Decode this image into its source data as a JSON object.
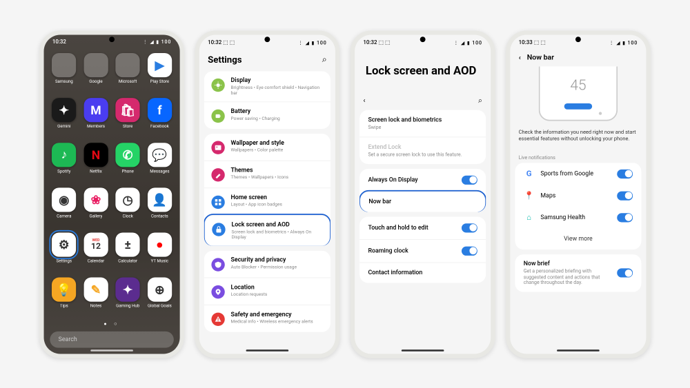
{
  "phone1": {
    "status_time": "10:32",
    "status_icons": "⋮ ◢ ▮ 100",
    "apps": [
      {
        "label": "Samsung",
        "kind": "folder"
      },
      {
        "label": "Google",
        "kind": "folder"
      },
      {
        "label": "Microsoft",
        "kind": "folder"
      },
      {
        "label": "Play Store",
        "bg": "#fff",
        "glyph": "▶",
        "fg": "#2a7de1"
      },
      {
        "label": "Gemini",
        "bg": "#1a1a1a",
        "glyph": "✦"
      },
      {
        "label": "Members",
        "bg": "#4a3df0",
        "glyph": "M"
      },
      {
        "label": "Store",
        "bg": "#d5296d",
        "glyph": "🛍"
      },
      {
        "label": "Facebook",
        "bg": "#0866ff",
        "glyph": "f"
      },
      {
        "label": "Spotify",
        "bg": "#1db954",
        "glyph": "♪"
      },
      {
        "label": "Netflix",
        "bg": "#000",
        "glyph": "N",
        "fg": "#e50914"
      },
      {
        "label": "Phone",
        "bg": "#25d366",
        "glyph": "✆"
      },
      {
        "label": "Messages",
        "bg": "#fff",
        "glyph": "💬",
        "fg": "#2a7de1"
      },
      {
        "label": "Camera",
        "bg": "#fff",
        "glyph": "◉",
        "fg": "#333"
      },
      {
        "label": "Gallery",
        "bg": "#fff",
        "glyph": "❀",
        "fg": "#e91e63"
      },
      {
        "label": "Clock",
        "bg": "#fff",
        "glyph": "◷",
        "fg": "#333"
      },
      {
        "label": "Contacts",
        "bg": "#fff",
        "glyph": "👤",
        "fg": "#e67e22"
      },
      {
        "label": "Settings",
        "bg": "#fff",
        "glyph": "⚙",
        "fg": "#333",
        "selected": true
      },
      {
        "label": "Calendar",
        "bg": "#fff",
        "glyph": "12",
        "fg": "#333",
        "badge": "WED"
      },
      {
        "label": "Calculator",
        "bg": "#fff",
        "glyph": "±",
        "fg": "#333"
      },
      {
        "label": "YT Music",
        "bg": "#fff",
        "glyph": "●",
        "fg": "#ff0000"
      },
      {
        "label": "Tips",
        "bg": "#f5a623",
        "glyph": "💡"
      },
      {
        "label": "Notes",
        "bg": "#fff",
        "glyph": "✎",
        "fg": "#f5a623"
      },
      {
        "label": "Gaming Hub",
        "bg": "#5b2c8f",
        "glyph": "✦"
      },
      {
        "label": "Global Goals",
        "bg": "#fff",
        "glyph": "⊕",
        "fg": "#333"
      }
    ],
    "page_dots": "● ○",
    "search_placeholder": "Search"
  },
  "phone2": {
    "status_time": "10:32 ⬚ ⬚",
    "status_icons": "⋮ ◢ ▮ 100",
    "title": "Settings",
    "groups": [
      [
        {
          "name": "Display",
          "sub": "Brightness • Eye comfort shield • Navigation bar",
          "color": "#8bc34a",
          "icon": "sun"
        },
        {
          "name": "Battery",
          "sub": "Power saving • Charging",
          "color": "#8bc34a",
          "icon": "battery"
        }
      ],
      [
        {
          "name": "Wallpaper and style",
          "sub": "Wallpapers • Color palette",
          "color": "#d5296d",
          "icon": "picture"
        },
        {
          "name": "Themes",
          "sub": "Themes • Wallpapers • Icons",
          "color": "#d5296d",
          "icon": "brush"
        },
        {
          "name": "Home screen",
          "sub": "Layout • App icon badges",
          "color": "#2a7de1",
          "icon": "grid"
        },
        {
          "name": "Lock screen and AOD",
          "sub": "Screen lock and biometrics • Always On Display",
          "color": "#2a7de1",
          "icon": "lock",
          "highlighted": true
        }
      ],
      [
        {
          "name": "Security and privacy",
          "sub": "Auto Blocker • Permission usage",
          "color": "#7a4de0",
          "icon": "shield"
        },
        {
          "name": "Location",
          "sub": "Location requests",
          "color": "#7a4de0",
          "icon": "pin"
        },
        {
          "name": "Safety and emergency",
          "sub": "Medical info • Wireless emergency alerts",
          "color": "#e53935",
          "icon": "alert"
        }
      ]
    ]
  },
  "phone3": {
    "status_time": "10:32 ⬚ ⬚",
    "status_icons": "⋮ ◢ ▮ 100",
    "title": "Lock screen and AOD",
    "group1": [
      {
        "name": "Screen lock and biometrics",
        "sub": "Swipe"
      },
      {
        "name": "Extend Lock",
        "sub": "Set a secure screen lock to use this feature.",
        "disabled": true
      }
    ],
    "group2": [
      {
        "name": "Always On Display",
        "toggle": true
      },
      {
        "name": "Now bar",
        "highlighted": true
      }
    ],
    "group3": [
      {
        "name": "Touch and hold to edit",
        "toggle": true
      },
      {
        "name": "Roaming clock",
        "toggle": true
      },
      {
        "name": "Contact information"
      }
    ]
  },
  "phone4": {
    "status_time": "10:33 ⬚ ⬚",
    "status_icons": "⋮ ◢ ▮ 100",
    "title": "Now bar",
    "preview_number": "45",
    "description": "Check the information you need right now and start essential features without unlocking your phone.",
    "section_label": "Live notifications",
    "live_items": [
      {
        "name": "Sports from Google",
        "icon": "G",
        "color": "#4285f4"
      },
      {
        "name": "Maps",
        "icon": "📍",
        "color": "#ea4335"
      },
      {
        "name": "Samsung Health",
        "icon": "⌂",
        "color": "#00b8a9"
      }
    ],
    "view_more": "View more",
    "now_brief": {
      "title": "Now brief",
      "sub": "Get a personalized briefing with suggested content and actions that change throughout the day."
    }
  }
}
